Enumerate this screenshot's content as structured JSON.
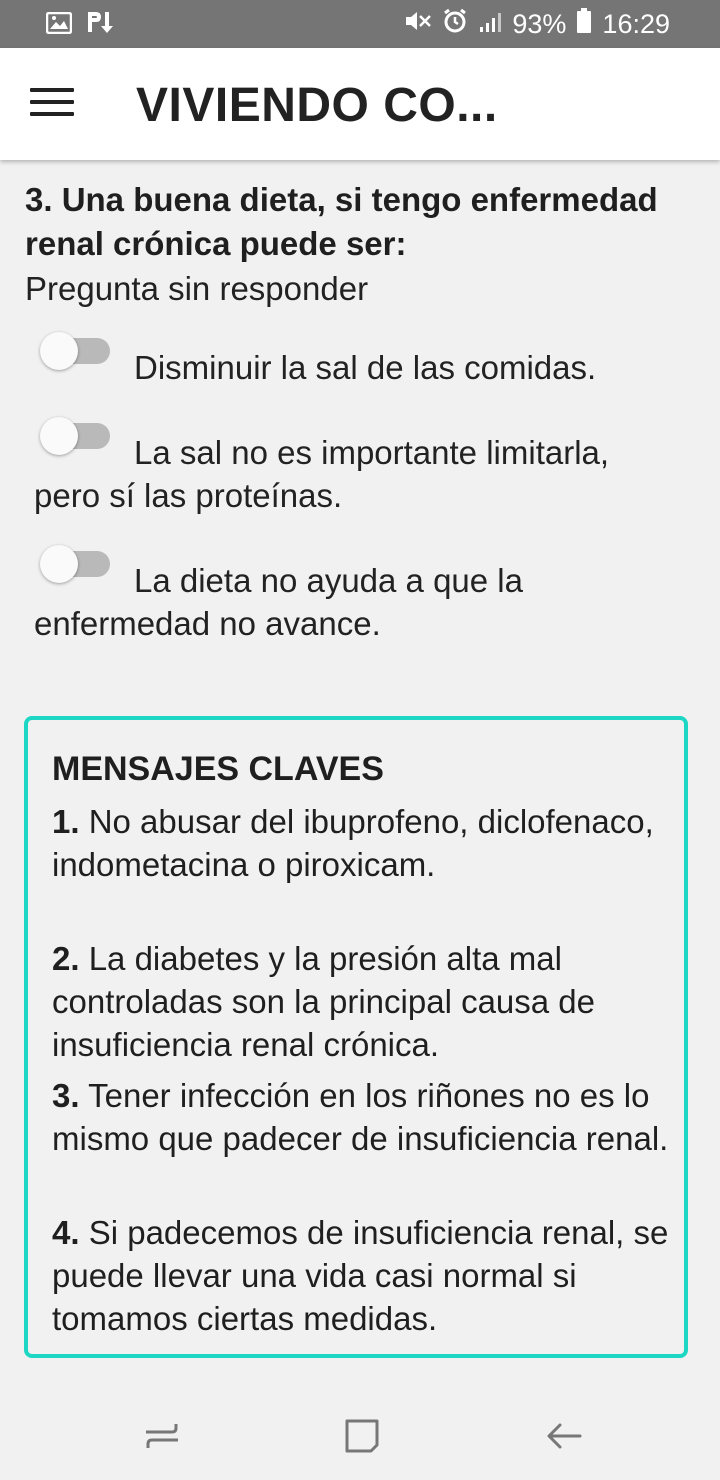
{
  "status_bar": {
    "battery": "93%",
    "time": "16:29",
    "icons": [
      "image-icon",
      "pl-icon",
      "mute-icon",
      "alarm-icon",
      "signal-icon",
      "battery-icon"
    ]
  },
  "app_bar": {
    "title": "VIVIENDO CO..."
  },
  "question": {
    "text": "3. Una buena dieta, si tengo enfermedad renal crónica puede ser:",
    "status": "Pregunta sin responder",
    "options": [
      {
        "label": "Disminuir la sal de las comidas.",
        "selected": false
      },
      {
        "label": "La sal no es importante limitarla, pero sí las proteínas.",
        "selected": false
      },
      {
        "label": "La dieta no ayuda a que la enfermedad no avance.",
        "selected": false
      }
    ]
  },
  "key_messages": {
    "title": "MENSAJES CLAVES",
    "items": [
      {
        "number": "1.",
        "text": "No abusar del ibuprofeno, diclofenaco, indometacina o piroxicam."
      },
      {
        "number": "2.",
        "text": "La diabetes y la presión alta mal controladas son la principal causa de insuficiencia renal crónica."
      },
      {
        "number": "3.",
        "text": "Tener infección en los riñones no es lo mismo que padecer de insuficiencia renal."
      },
      {
        "number": "4.",
        "text": "Si padecemos de insuficiencia renal, se puede llevar una vida casi normal si tomamos ciertas medidas."
      }
    ],
    "border_color": "#1dd6c4"
  },
  "nav_bar": {
    "icons": [
      "recent-apps-icon",
      "home-icon",
      "back-icon"
    ]
  }
}
